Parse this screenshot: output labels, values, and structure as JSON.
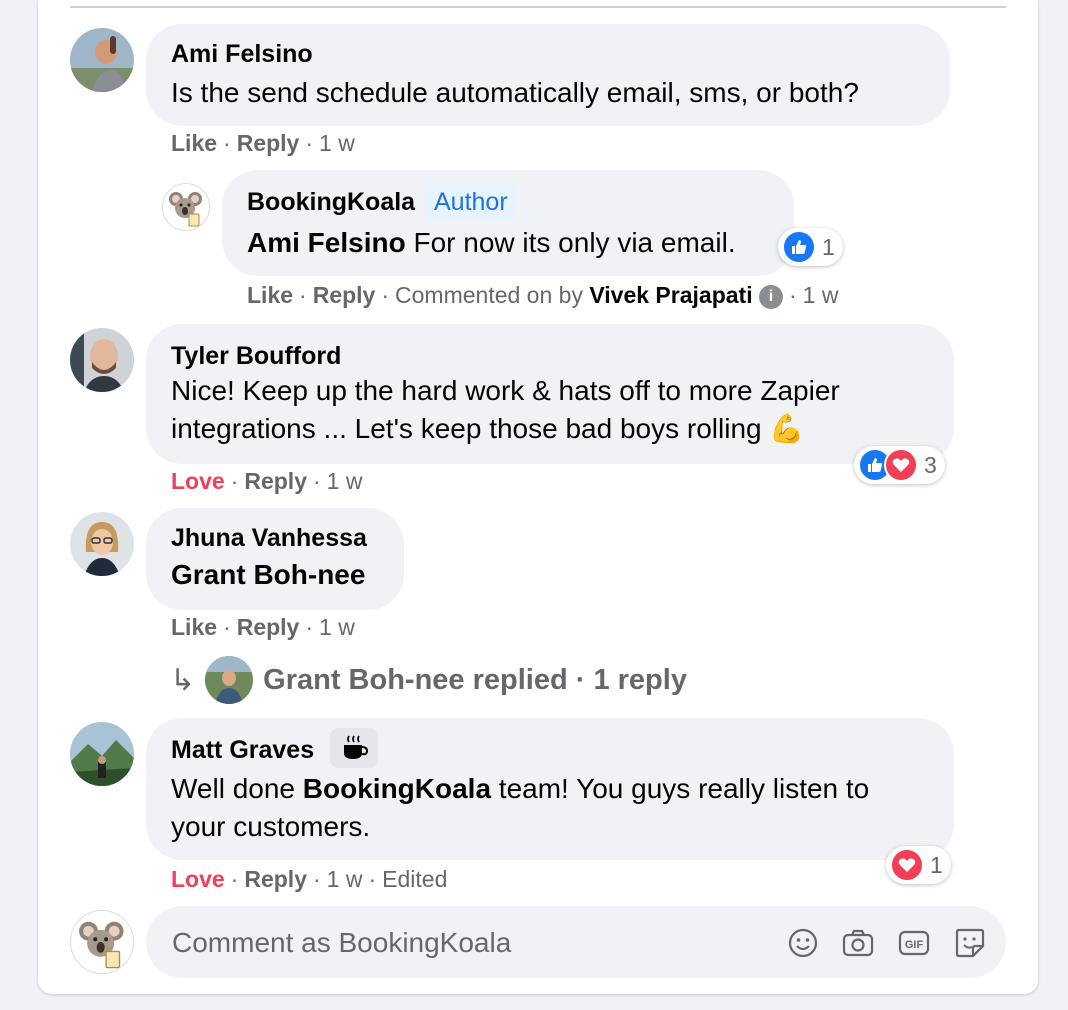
{
  "comments": [
    {
      "author": "Ami Felsino",
      "text": "Is the send schedule automatically email, sms, or both?",
      "actions": {
        "like": "Like",
        "reply": "Reply",
        "time": "1 w"
      }
    },
    {
      "author": "BookingKoala",
      "badge": "Author",
      "mention": "Ami Felsino",
      "text": " For now its only via email.",
      "reaction_count": "1",
      "actions": {
        "like": "Like",
        "reply": "Reply",
        "commented_on_by": "Commented on by",
        "by_name": "Vivek Prajapati",
        "time": "1 w"
      }
    },
    {
      "author": "Tyler Boufford",
      "text_line1": "Nice! Keep up the hard work & hats off to more Zapier",
      "text_line2": "integrations ... Let's keep those bad boys rolling 💪",
      "reaction_count": "3",
      "actions": {
        "love": "Love",
        "reply": "Reply",
        "time": "1 w"
      }
    },
    {
      "author": "Jhuna Vanhessa",
      "mention": "Grant Boh-nee",
      "actions": {
        "like": "Like",
        "reply": "Reply",
        "time": "1 w"
      },
      "replies": {
        "label": "Grant Boh-nee replied · 1 reply"
      }
    },
    {
      "author": "Matt Graves",
      "text_pre": "Well done ",
      "text_bold": "BookingKoala",
      "text_post": " team! You guys really listen to",
      "text_line2": "your customers.",
      "reaction_count": "1",
      "actions": {
        "love": "Love",
        "reply": "Reply",
        "time": "1 w",
        "edited": "Edited"
      }
    }
  ],
  "composer": {
    "placeholder": "Comment as BookingKoala",
    "icons": [
      "emoji-icon",
      "camera-icon",
      "gif-icon",
      "sticker-icon"
    ]
  },
  "colors": {
    "like_blue": "#1877f2",
    "love_red": "#f33e58",
    "author_badge_bg": "#e7f3ff",
    "author_badge_text": "#1b74e4"
  }
}
